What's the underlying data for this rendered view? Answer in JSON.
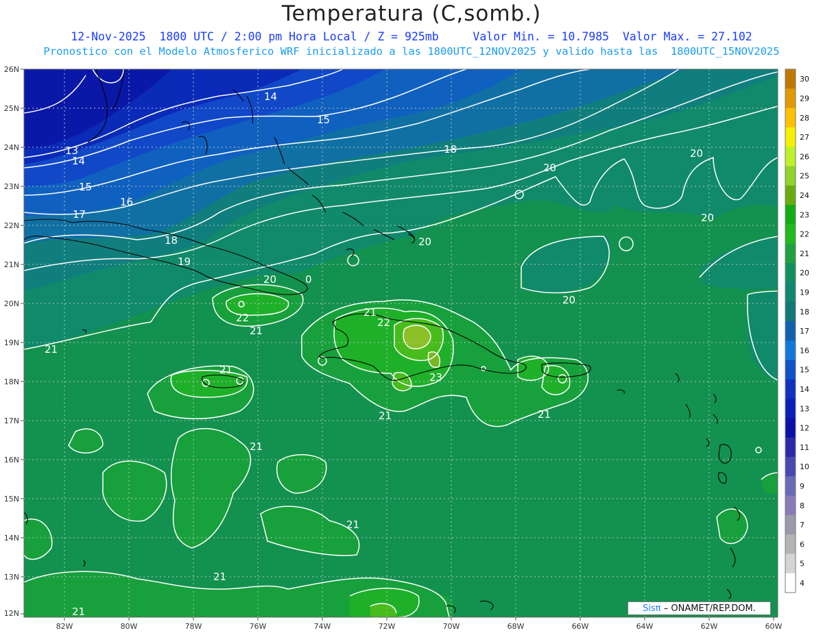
{
  "header": {
    "title": "Temperatura (C,somb.)",
    "subtitle1": "12-Nov-2025  1800 UTC / 2:00 pm Hora Local / Z = 925mb     Valor Min. = 10.7985  Valor Max. = 27.102",
    "subtitle2": "Pronostico con el Modelo Atmosferico WRF inicializado a las 1800UTC_12NOV2025 y valido hasta las  1800UTC_15NOV2025"
  },
  "axes": {
    "lat_labels": [
      "26N",
      "25N",
      "24N",
      "23N",
      "22N",
      "21N",
      "20N",
      "19N",
      "18N",
      "17N",
      "16N",
      "15N",
      "14N",
      "13N",
      "12N"
    ],
    "lon_labels": [
      "82W",
      "80W",
      "78W",
      "76W",
      "74W",
      "72W",
      "70W",
      "68W",
      "66W",
      "64W",
      "62W",
      "60W"
    ]
  },
  "colorbar": {
    "labels": [
      "30",
      "29",
      "28",
      "27",
      "26",
      "25",
      "24",
      "23",
      "22",
      "21",
      "20",
      "19",
      "18",
      "17",
      "16",
      "15",
      "14",
      "13",
      "12",
      "11",
      "10",
      "9",
      "8",
      "7",
      "6",
      "5",
      "4"
    ],
    "colors": [
      "#c07800",
      "#e09a00",
      "#ffc000",
      "#f6f000",
      "#bdf22a",
      "#8ed42a",
      "#6aac10",
      "#14ac14",
      "#20ba20",
      "#20a040",
      "#109060",
      "#108870",
      "#107878",
      "#1060b0",
      "#1078d8",
      "#1050c8",
      "#1030c0",
      "#0820b8",
      "#0a10a8",
      "#2a2aa8",
      "#4848b0",
      "#6a6ab8",
      "#8a7ab8",
      "#9a9aaa",
      "#b4b4b4",
      "#d4d4d4",
      "#ffffff"
    ]
  },
  "contours": [
    {
      "label": "13"
    },
    {
      "label": "14"
    },
    {
      "label": "14"
    },
    {
      "label": "15"
    },
    {
      "label": "15"
    },
    {
      "label": "16"
    },
    {
      "label": "17"
    },
    {
      "label": "18"
    },
    {
      "label": "18"
    },
    {
      "label": "19"
    },
    {
      "label": "20"
    },
    {
      "label": "20"
    },
    {
      "label": "20"
    },
    {
      "label": "20"
    },
    {
      "label": "20"
    },
    {
      "label": "20"
    },
    {
      "label": "0"
    },
    {
      "label": "22"
    },
    {
      "label": "21"
    },
    {
      "label": "21"
    },
    {
      "label": "22"
    },
    {
      "label": "23"
    },
    {
      "label": "21"
    },
    {
      "label": "21"
    },
    {
      "label": "21"
    },
    {
      "label": "21"
    },
    {
      "label": "21"
    },
    {
      "label": "21"
    },
    {
      "label": "21"
    },
    {
      "label": "21"
    }
  ],
  "credit": {
    "sis": "Sisπ",
    "org": "– ONAMET/REP.DOM."
  }
}
